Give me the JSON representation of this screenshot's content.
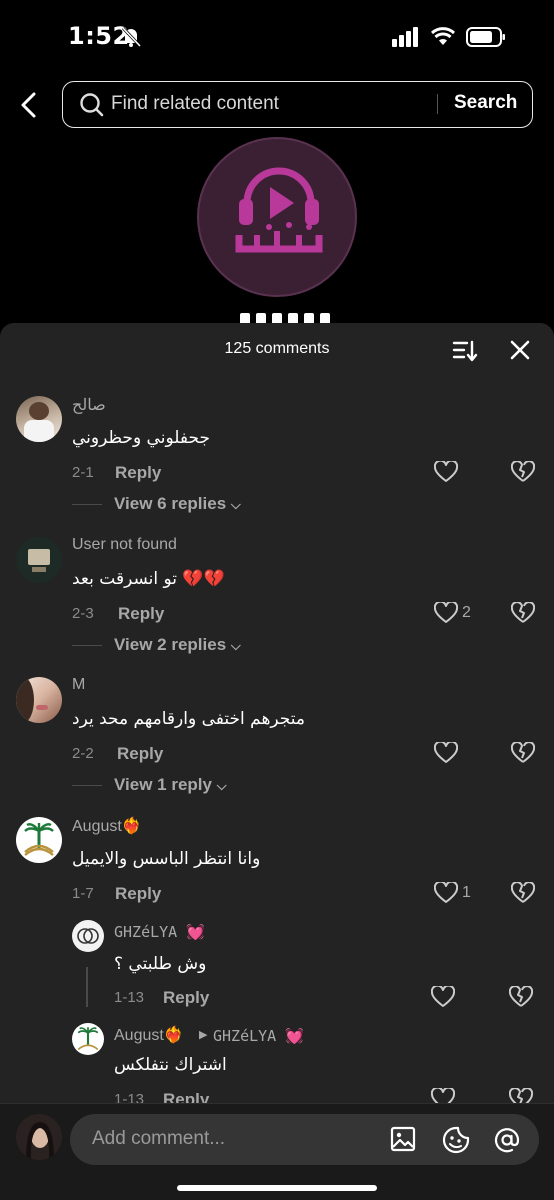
{
  "status": {
    "time": "1:52"
  },
  "search": {
    "placeholder": "Find related content",
    "button": "Search"
  },
  "sheet": {
    "title": "125 comments"
  },
  "comments": [
    {
      "name": "صالح",
      "text": "جحفلوني وحظروني",
      "date": "2-1",
      "reply": "Reply",
      "likes": "",
      "view_replies": "View 6 replies"
    },
    {
      "name": "User not found",
      "text": "تو انسرقت بعد 💔💔",
      "date": "2-3",
      "reply": "Reply",
      "likes": "2",
      "view_replies": "View 2 replies"
    },
    {
      "name": "M",
      "text": "متجرهم اختفى وارقامهم محد يرد",
      "date": "2-2",
      "reply": "Reply",
      "likes": "",
      "view_replies": "View 1 reply"
    },
    {
      "name": "August❤️‍🔥",
      "text": "وانا انتظر الباسس والايميل",
      "date": "1-7",
      "reply": "Reply",
      "likes": "1",
      "view_replies": ""
    }
  ],
  "replies": [
    {
      "name": "GHZéLYA 💓",
      "text": "وش طلبتي ؟",
      "date": "1-13",
      "reply": "Reply"
    },
    {
      "name": "August❤️‍🔥",
      "reply_to": "GHZéLYA 💓",
      "text": "اشتراك نتفلكس",
      "date": "1-13",
      "reply": "Reply"
    }
  ],
  "composer": {
    "placeholder": "Add comment..."
  },
  "colors": {
    "sheet_bg": "#232323",
    "logo_accent": "#a8348e",
    "bar_bg": "#1a1a1a"
  }
}
